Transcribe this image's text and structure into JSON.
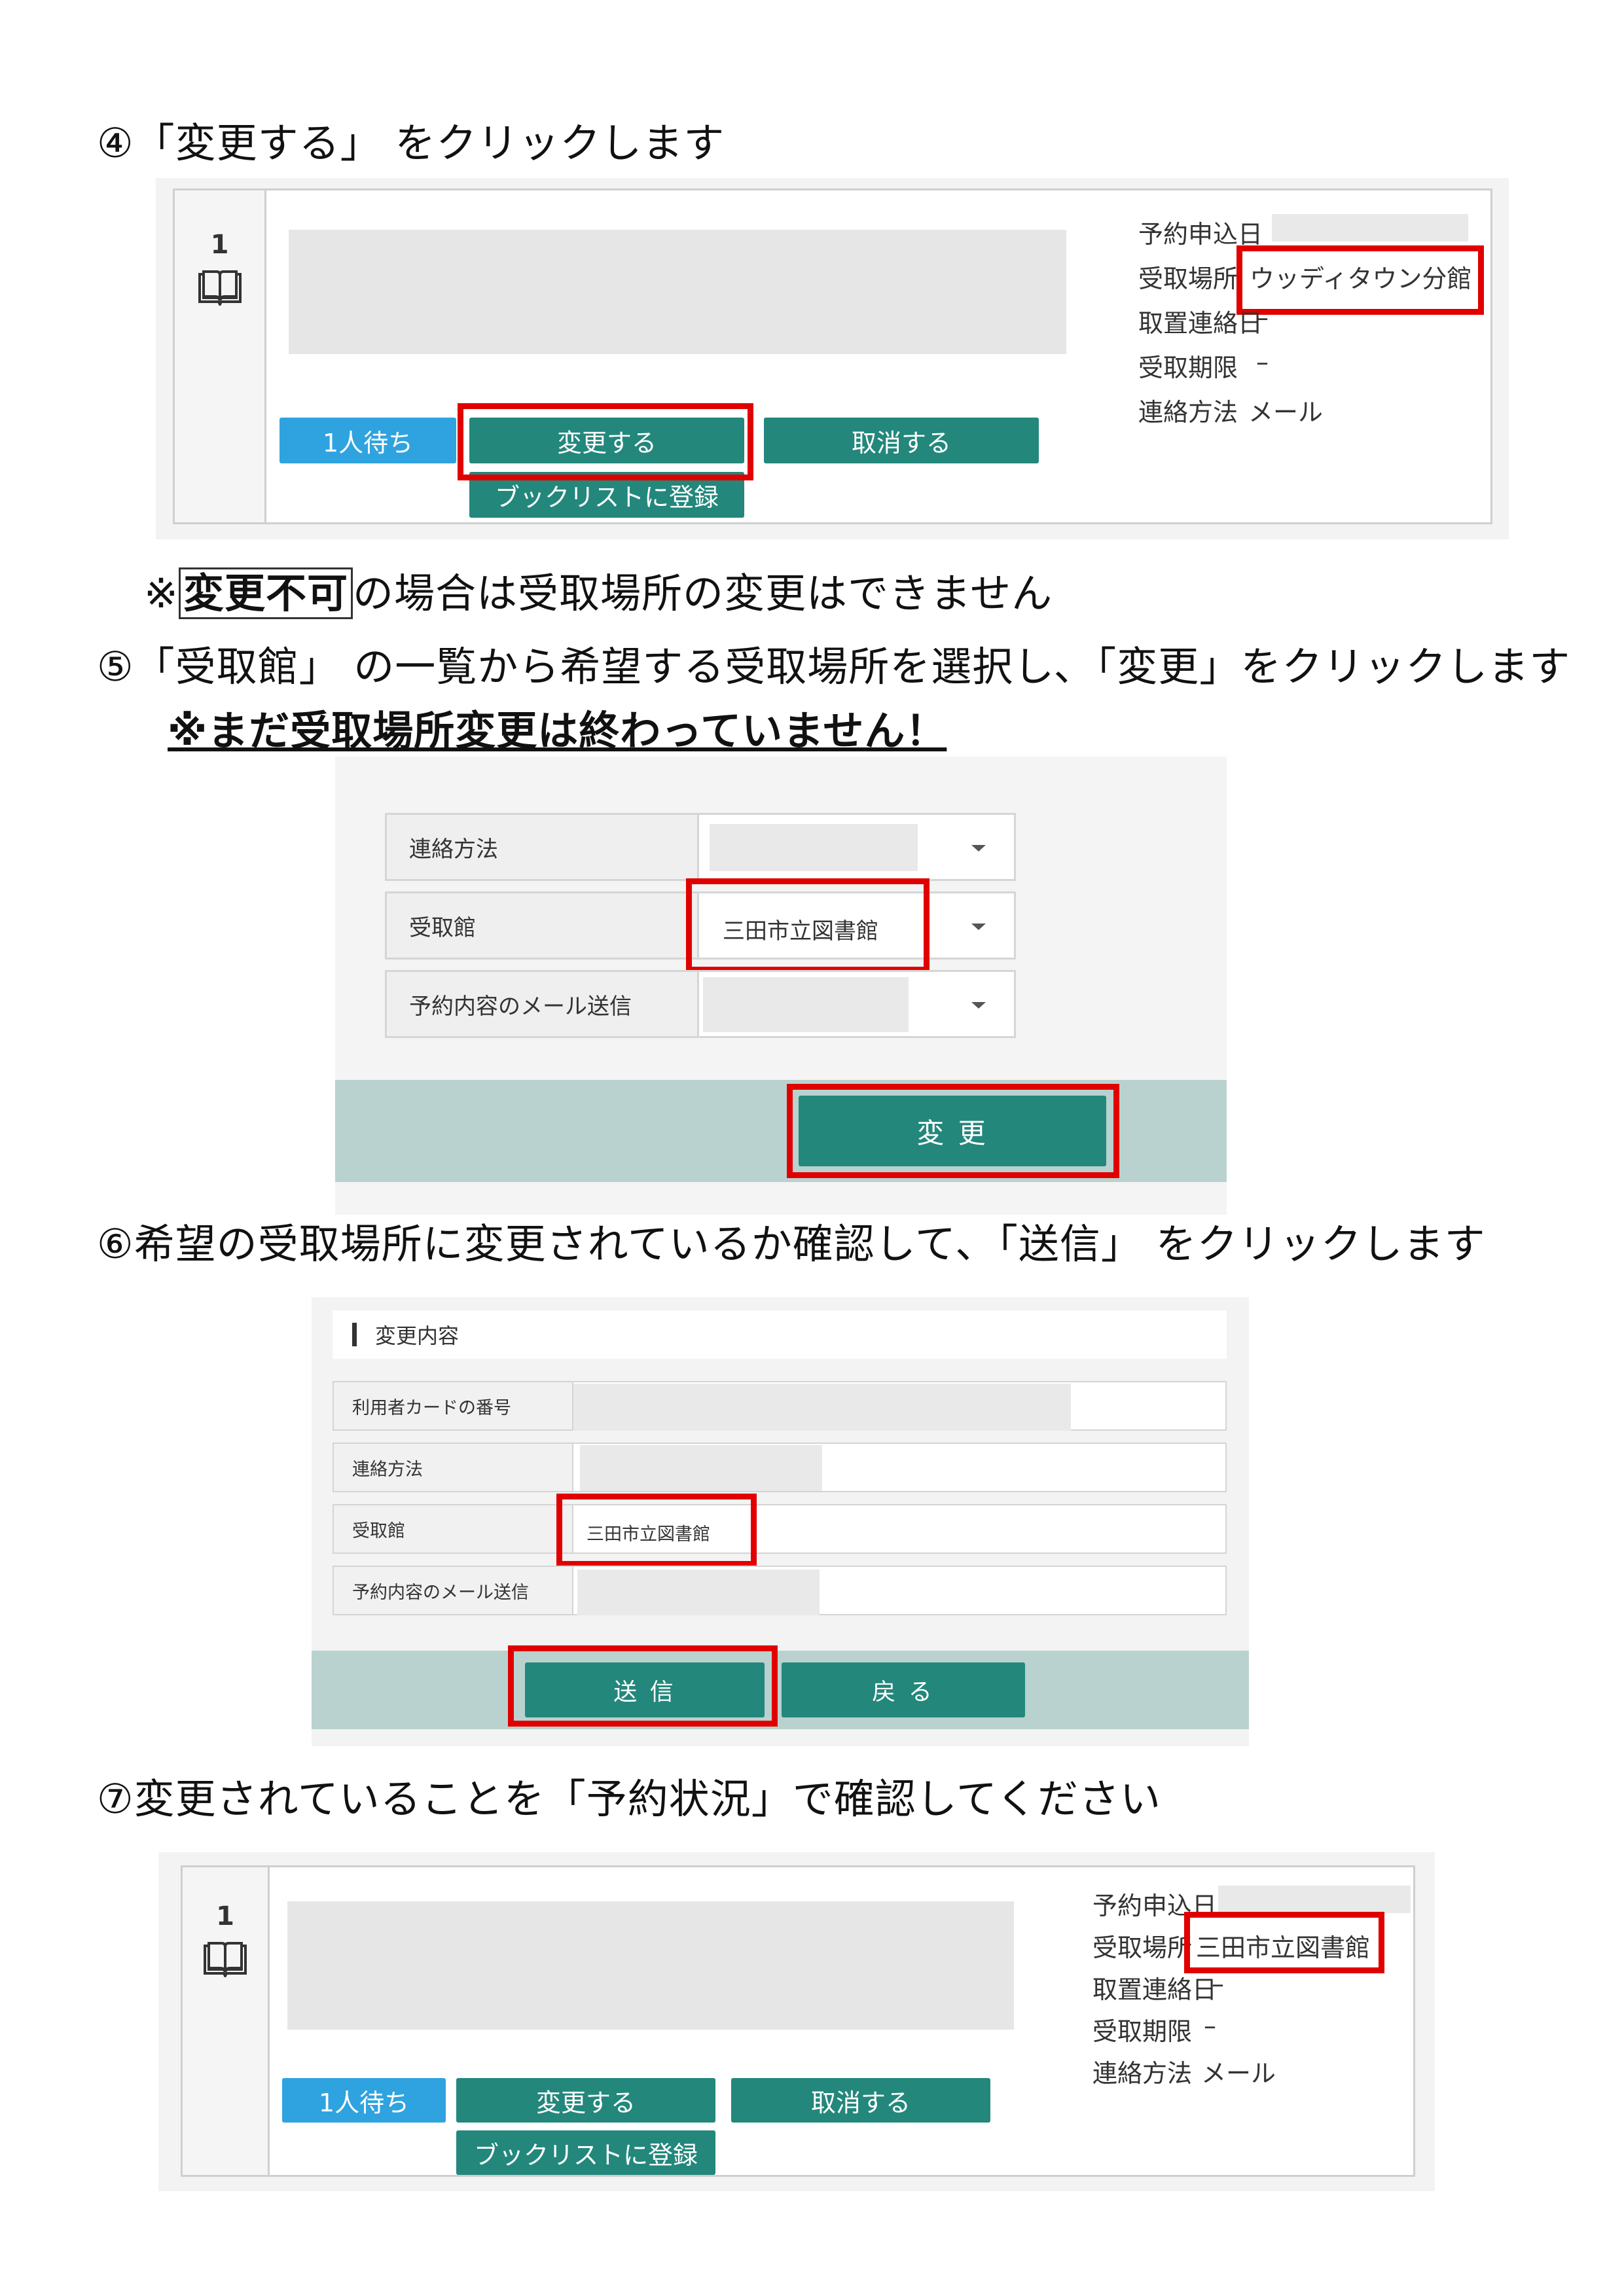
{
  "step4": {
    "heading": "④「変更する」 をクリックします",
    "reservation": {
      "number": "1",
      "buttons": {
        "wait": "1人待ち",
        "change": "変更する",
        "cancel": "取消する",
        "booklist": "ブックリストに登録"
      },
      "info": {
        "reserve_date_label": "予約申込日",
        "pickup_label": "受取場所",
        "pickup_value": "ウッディタウン分館",
        "hold_date_label": "取置連絡日",
        "hold_date_value": "–",
        "deadline_label": "受取期限",
        "deadline_value": "–",
        "contact_label": "連絡方法",
        "contact_value": "メール"
      }
    },
    "note_prefix": "※",
    "note_boxed": "変更不可",
    "note_suffix": "の場合は受取場所の変更はできません"
  },
  "step5": {
    "heading": "⑤「受取館」 の一覧から希望する受取場所を選択し､「変更」をクリックします",
    "warning": "※まだ受取場所変更は終わっていません！",
    "form": {
      "contact_label": "連絡方法",
      "library_label": "受取館",
      "library_value": "三田市立図書館",
      "mail_label": "予約内容のメール送信",
      "submit": "変 更"
    }
  },
  "step6": {
    "heading": "⑥希望の受取場所に変更されているか確認して､「送信」 をクリックします",
    "confirm": {
      "section_title": "変更内容",
      "card_label": "利用者カードの番号",
      "contact_label": "連絡方法",
      "library_label": "受取館",
      "library_value": "三田市立図書館",
      "mail_label": "予約内容のメール送信",
      "send": "送 信",
      "back": "戻 る"
    }
  },
  "step7": {
    "heading": "⑦変更されていることを「予約状況」で確認してください",
    "reservation": {
      "number": "1",
      "buttons": {
        "wait": "1人待ち",
        "change": "変更する",
        "cancel": "取消する",
        "booklist": "ブックリストに登録"
      },
      "info": {
        "reserve_date_label": "予約申込日",
        "pickup_label": "受取場所",
        "pickup_value": "三田市立図書館",
        "hold_date_label": "取置連絡日",
        "hold_date_value": "–",
        "deadline_label": "受取期限",
        "deadline_value": "–",
        "contact_label": "連絡方法",
        "contact_value": "メール"
      }
    }
  }
}
